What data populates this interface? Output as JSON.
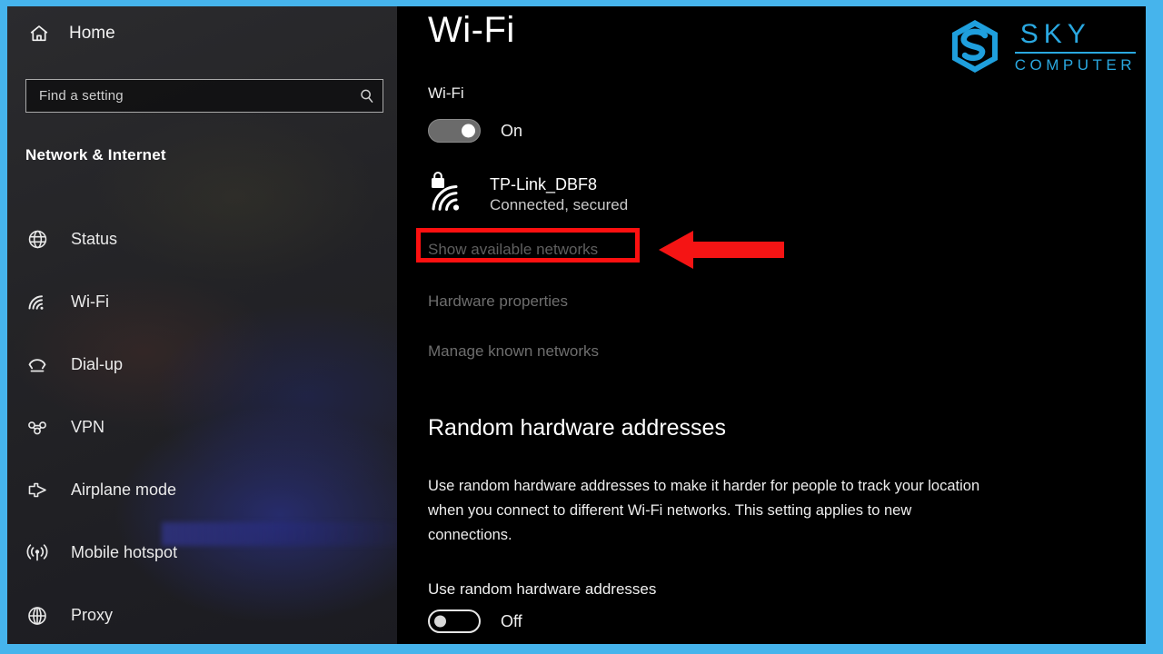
{
  "window": {
    "accent_color": "#46b4ec",
    "sidebar_bg": "#262629",
    "main_bg": "#000000"
  },
  "sidebar": {
    "home": {
      "label": "Home",
      "icon": "home-icon"
    },
    "search": {
      "placeholder": "Find a setting",
      "value": "Find a setting",
      "icon": "search-icon"
    },
    "section_title": "Network & Internet",
    "items": [
      {
        "label": "Status",
        "icon": "globe-status-icon"
      },
      {
        "label": "Wi-Fi",
        "icon": "wifi-icon"
      },
      {
        "label": "Dial-up",
        "icon": "dialup-icon"
      },
      {
        "label": "VPN",
        "icon": "vpn-icon"
      },
      {
        "label": "Airplane mode",
        "icon": "airplane-icon"
      },
      {
        "label": "Mobile hotspot",
        "icon": "hotspot-icon"
      },
      {
        "label": "Proxy",
        "icon": "proxy-globe-icon"
      }
    ]
  },
  "main": {
    "page_title": "Wi-Fi",
    "wifi_section": {
      "label": "Wi-Fi",
      "toggle_state": "On",
      "toggle_on": true
    },
    "network": {
      "name": "TP-Link_DBF8",
      "status": "Connected, secured",
      "icon": "wifi-secured-icon"
    },
    "links": [
      "Show available networks",
      "Hardware properties",
      "Manage known networks"
    ],
    "random_hw": {
      "heading": "Random hardware addresses",
      "description": "Use random hardware addresses to make it harder for people to track your location when you connect to different Wi-Fi networks. This setting applies to new connections.",
      "toggle_label": "Use random hardware addresses",
      "toggle_state": "Off",
      "toggle_on": false
    }
  },
  "annotations": {
    "highlight_color": "#fc1010",
    "highlight_target": "Show available networks",
    "arrow_direction": "left",
    "arrow_color": "#f51414"
  },
  "logo": {
    "mark": "sky-hexagon-s-icon",
    "line1": "SKY",
    "line2": "COMPUTER",
    "color": "#2aa8e0"
  }
}
